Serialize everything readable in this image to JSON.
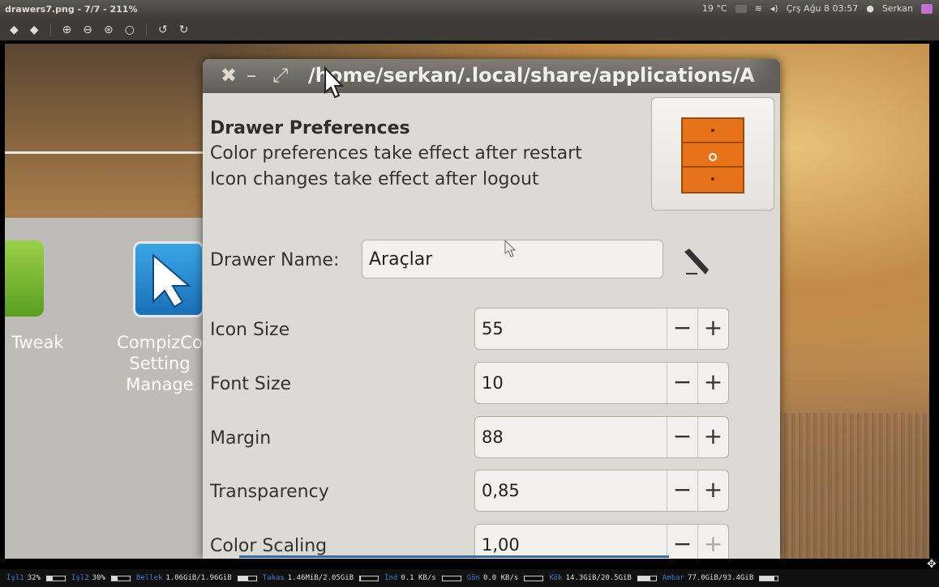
{
  "panel": {
    "title": "drawers7.png - 7/7 - 211%",
    "temperature": "19 °C",
    "datetime": "Çrş Ağu 8 03:57",
    "user": "Serkan"
  },
  "toolbar": {
    "icons": [
      "back-icon",
      "forward-icon",
      "zoom-in-icon",
      "zoom-out-icon",
      "zoom-fit-icon",
      "zoom-normal-icon",
      "rotate-left-icon",
      "rotate-right-icon"
    ]
  },
  "background_apps": [
    {
      "label": "Tweak",
      "icon": "ubuntu-tweak-icon"
    },
    {
      "label": "CompizCo\nSetting\nManage",
      "icon": "ccsm-icon"
    }
  ],
  "window": {
    "title": "/home/serkan/.local/share/applications/A",
    "heading": "Drawer Preferences",
    "note_color": "Color preferences take effect after restart",
    "note_icon": "Icon changes take effect after logout",
    "drawer_name_label": "Drawer Name:",
    "drawer_name_value": "Araçlar",
    "rows": [
      {
        "label": "Icon Size",
        "value": "55"
      },
      {
        "label": "Font Size",
        "value": "10"
      },
      {
        "label": "Margin",
        "value": "88"
      },
      {
        "label": "Transparency",
        "value": "0,85"
      },
      {
        "label": "Color Scaling",
        "value": "1,00"
      }
    ]
  },
  "status": {
    "cpu1_label": "İşl1",
    "cpu1_value": "32%",
    "cpu1_level": 0.32,
    "cpu2_label": "İşl2",
    "cpu2_value": "30%",
    "cpu2_level": 0.3,
    "mem_label": "Bellek",
    "mem_value": "1.06GiB/1.96GiB",
    "mem_level": 0.54,
    "swap_label": "Takas",
    "swap_value": "1.46MiB/2.05GiB",
    "swap_level": 0.01,
    "down_label": "İnd",
    "down_value": "0.1 KB/s",
    "up_label": "Gön",
    "up_value": "0.0 KB/s",
    "root_label": "Kök",
    "root_value": "14.3GiB/20.5GiB",
    "root_level": 0.7,
    "store_label": "Ambar",
    "store_value": "77.0GiB/93.4GiB",
    "store_level": 0.82
  }
}
